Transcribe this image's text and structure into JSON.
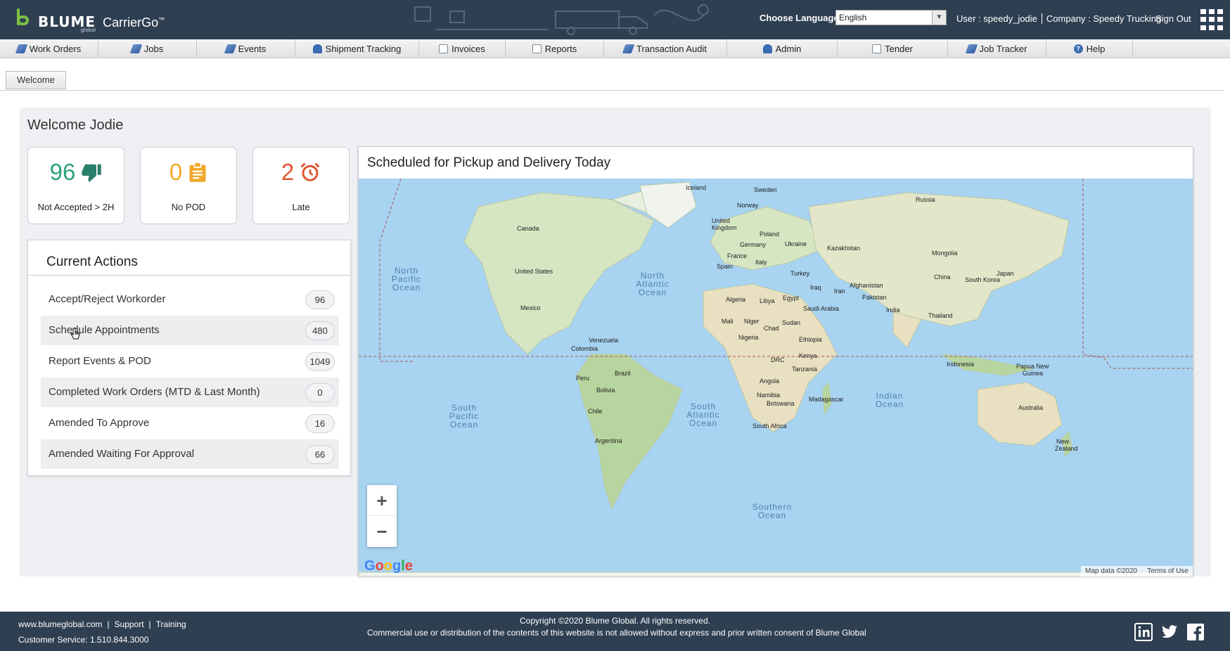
{
  "header": {
    "brand": "BLUME",
    "brand_sub": "global",
    "product": "CarrierGo",
    "product_mark": "™",
    "language_label": "Choose Language:",
    "language_value": "English",
    "user": "User : speedy_jodie",
    "company": "Company : Speedy Trucking",
    "sign_out": "Sign Out"
  },
  "nav": {
    "items": [
      {
        "label": "Work Orders",
        "icon": "work-orders-icon"
      },
      {
        "label": "Jobs",
        "icon": "jobs-icon"
      },
      {
        "label": "Events",
        "icon": "events-icon"
      },
      {
        "label": "Shipment Tracking",
        "icon": "shipment-tracking-icon"
      },
      {
        "label": "Invoices",
        "icon": "invoices-icon"
      },
      {
        "label": "Reports",
        "icon": "reports-icon"
      },
      {
        "label": "Transaction Audit",
        "icon": "transaction-audit-icon"
      },
      {
        "label": "Admin",
        "icon": "admin-icon"
      },
      {
        "label": "Tender",
        "icon": "tender-icon"
      },
      {
        "label": "Job Tracker",
        "icon": "job-tracker-icon"
      },
      {
        "label": "Help",
        "icon": "help-icon"
      }
    ]
  },
  "tabs": {
    "welcome": "Welcome"
  },
  "main": {
    "welcome_title": "Welcome Jodie",
    "stats": [
      {
        "value": "96",
        "label": "Not Accepted > 2H",
        "icon": "thumbs-down-icon",
        "color": "#2aa27c"
      },
      {
        "value": "0",
        "label": "No POD",
        "icon": "clipboard-icon",
        "color": "#f0a92c"
      },
      {
        "value": "2",
        "label": "Late",
        "icon": "alarm-clock-icon",
        "color": "#e0552f"
      }
    ],
    "actions": {
      "title": "Current Actions",
      "items": [
        {
          "label": "Accept/Reject Workorder",
          "count": "96"
        },
        {
          "label": "Schedule Appointments",
          "count": "480"
        },
        {
          "label": "Report Events & POD",
          "count": "1049"
        },
        {
          "label": "Completed Work Orders (MTD & Last Month)",
          "count": "0"
        },
        {
          "label": "Amended To Approve",
          "count": "16"
        },
        {
          "label": "Amended Waiting For Approval",
          "count": "66"
        }
      ]
    },
    "map": {
      "title": "Scheduled for Pickup and Delivery Today",
      "zoom_in": "+",
      "zoom_out": "−",
      "google": [
        "G",
        "o",
        "o",
        "g",
        "l",
        "e"
      ],
      "attribution": "Map data ©2020",
      "terms": "Terms of Use",
      "oceans": [
        "North Pacific Ocean",
        "North Atlantic Ocean",
        "South Pacific Ocean",
        "South Atlantic Ocean",
        "Indian Ocean",
        "Southern Ocean"
      ],
      "countries": [
        "Iceland",
        "Sweden",
        "Norway",
        "Russia",
        "Canada",
        "United Kingdom",
        "Poland",
        "Germany",
        "Ukraine",
        "Kazakhstan",
        "Mongolia",
        "France",
        "Italy",
        "Spain",
        "Turkey",
        "Afghanistan",
        "China",
        "Japan",
        "South Korea",
        "United States",
        "Iraq",
        "Iran",
        "Pakistan",
        "Libya",
        "Egypt",
        "Algeria",
        "Saudi Arabia",
        "India",
        "Mexico",
        "Mali",
        "Niger",
        "Chad",
        "Sudan",
        "Thailand",
        "Venezuela",
        "Colombia",
        "Nigeria",
        "Ethiopia",
        "Kenya",
        "DRC",
        "Tanzania",
        "Peru",
        "Brazil",
        "Bolivia",
        "Angola",
        "Namibia",
        "Botswana",
        "Madagascar",
        "Indonesia",
        "Papua New Guinea",
        "Chile",
        "South Africa",
        "Australia",
        "Argentina",
        "New Zealand"
      ]
    }
  },
  "footer": {
    "site": "www.blumeglobal.com",
    "support": "Support",
    "training": "Training",
    "customer_service": "Customer Service: 1.510.844.3000",
    "copyright": "Copyright ©2020 Blume Global. All rights reserved.",
    "legal": "Commercial use or distribution of the contents of this website is not allowed without express and prior written consent of Blume Global",
    "social": [
      "linkedin-icon",
      "twitter-icon",
      "facebook-icon"
    ]
  }
}
